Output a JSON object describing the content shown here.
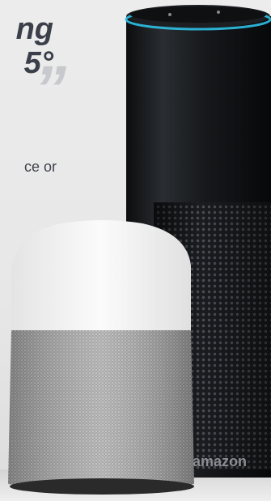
{
  "headline": {
    "line1": "ng",
    "line2": "5°",
    "quote": "”"
  },
  "subtext": "ce or",
  "echo": {
    "brand": "amazon"
  },
  "colors": {
    "echo_body": "#17191c",
    "echo_ring": "#2fc1e5",
    "home_top": "#f4f4f4",
    "home_fabric": "#a9a9a9"
  }
}
